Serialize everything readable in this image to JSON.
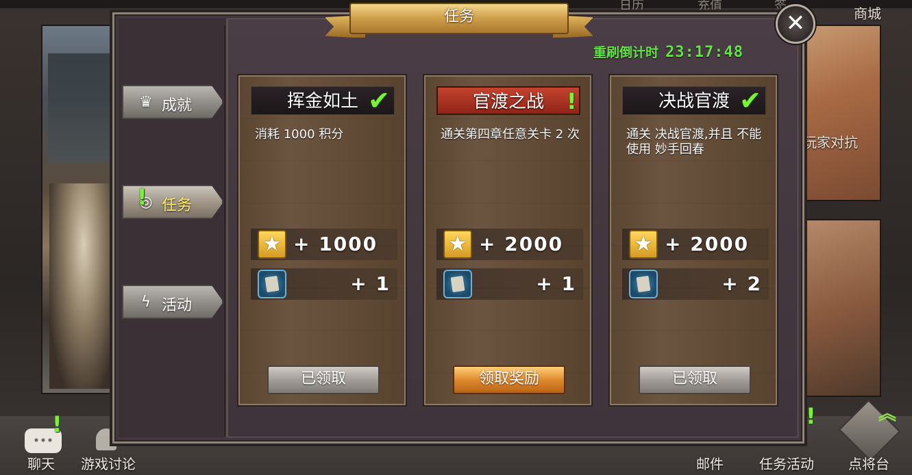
{
  "background": {
    "top_nav_ghost": [
      "日历",
      "充值",
      "签"
    ],
    "shop_label": "商城",
    "pvp_label": "玩家对抗"
  },
  "dialog": {
    "title": "任务",
    "refresh_label": "重刷倒计时",
    "countdown": "23:17:48"
  },
  "tabs": [
    {
      "label": "成就",
      "icon": "crown-icon",
      "active": false
    },
    {
      "label": "任务",
      "icon": "task-icon",
      "active": true
    },
    {
      "label": "活动",
      "icon": "lightning-icon",
      "active": false
    }
  ],
  "cards": [
    {
      "title": "挥金如土",
      "status": "completed",
      "description": "消耗 1000 积分",
      "reward_points": "+ 1000",
      "reward_cards": "+ 1",
      "button": "已领取"
    },
    {
      "title": "官渡之战",
      "status": "claimable",
      "description": "通关第四章任意关卡 2 次",
      "reward_points": "+ 2000",
      "reward_cards": "+ 1",
      "button": "领取奖励"
    },
    {
      "title": "决战官渡",
      "status": "completed",
      "description": "通关 决战官渡,并且 不能使用 妙手回春",
      "reward_points": "+ 2000",
      "reward_cards": "+ 2",
      "button": "已领取"
    }
  ],
  "bottom_bar": {
    "chat": "聊天",
    "forum": "游戏讨论",
    "mail": "邮件",
    "task_activity": "任务活动",
    "general": "点将台"
  },
  "colors": {
    "accent_green": "#7cf03a",
    "timer_green": "#63e346",
    "claim_orange": "#e08a2e",
    "banner_gold": "#d2a24d"
  }
}
